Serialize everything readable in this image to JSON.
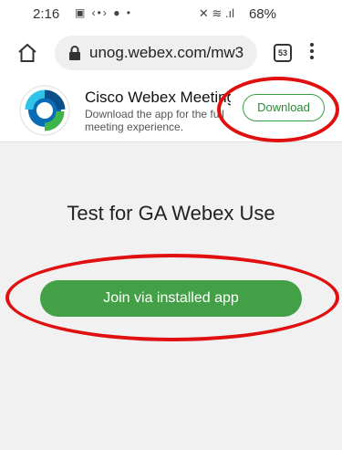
{
  "status_bar": {
    "time": "2:16",
    "notification_icons": "▣ ‹•› ● •",
    "signal_icons": "✕ ≋ .ıl",
    "battery": "68%"
  },
  "browser": {
    "url": "unog.webex.com/mw3",
    "tab_count": "53"
  },
  "app_banner": {
    "title": "Cisco Webex Meetings",
    "description": "Download the app for the full meeting experience.",
    "download_label": "Download"
  },
  "meeting": {
    "title": "Test for GA Webex Use",
    "join_label": "Join via installed app"
  },
  "colors": {
    "accent_green": "#43a047",
    "annotation_red": "#e01010"
  }
}
